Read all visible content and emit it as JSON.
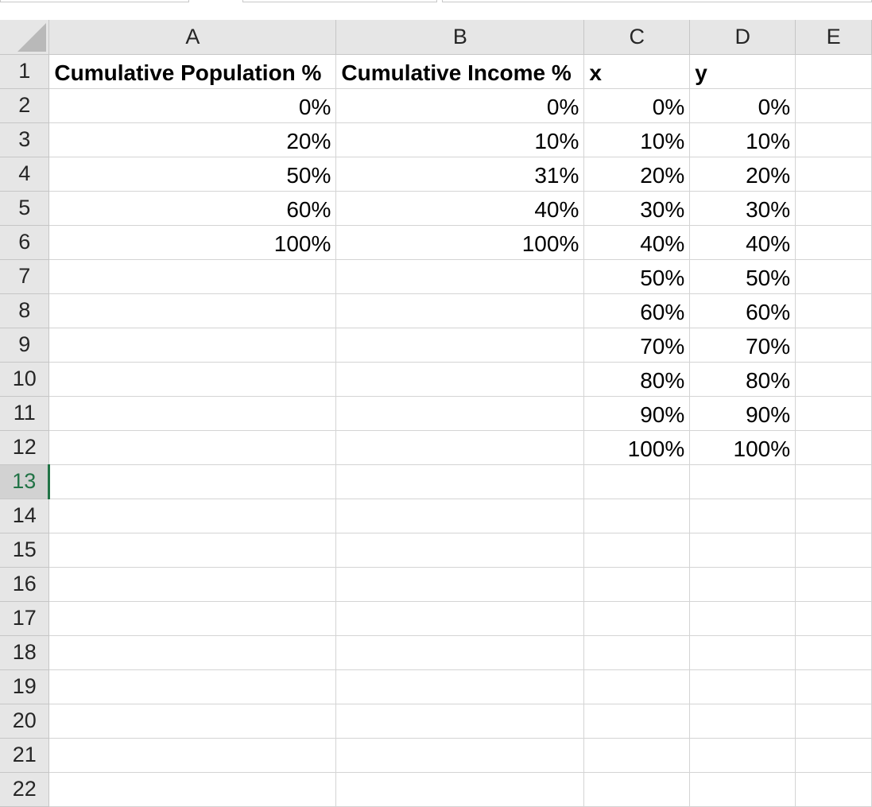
{
  "columns": [
    "A",
    "B",
    "C",
    "D",
    "E"
  ],
  "rows": [
    {
      "num": "1",
      "cells": [
        "Cumulative Population %",
        "Cumulative Income %",
        "x",
        "y",
        ""
      ]
    },
    {
      "num": "2",
      "cells": [
        "0%",
        "0%",
        "0%",
        "0%",
        ""
      ]
    },
    {
      "num": "3",
      "cells": [
        "20%",
        "10%",
        "10%",
        "10%",
        ""
      ]
    },
    {
      "num": "4",
      "cells": [
        "50%",
        "31%",
        "20%",
        "20%",
        ""
      ]
    },
    {
      "num": "5",
      "cells": [
        "60%",
        "40%",
        "30%",
        "30%",
        ""
      ]
    },
    {
      "num": "6",
      "cells": [
        "100%",
        "100%",
        "40%",
        "40%",
        ""
      ]
    },
    {
      "num": "7",
      "cells": [
        "",
        "",
        "50%",
        "50%",
        ""
      ]
    },
    {
      "num": "8",
      "cells": [
        "",
        "",
        "60%",
        "60%",
        ""
      ]
    },
    {
      "num": "9",
      "cells": [
        "",
        "",
        "70%",
        "70%",
        ""
      ]
    },
    {
      "num": "10",
      "cells": [
        "",
        "",
        "80%",
        "80%",
        ""
      ]
    },
    {
      "num": "11",
      "cells": [
        "",
        "",
        "90%",
        "90%",
        ""
      ]
    },
    {
      "num": "12",
      "cells": [
        "",
        "",
        "100%",
        "100%",
        ""
      ]
    },
    {
      "num": "13",
      "cells": [
        "",
        "",
        "",
        "",
        ""
      ]
    },
    {
      "num": "14",
      "cells": [
        "",
        "",
        "",
        "",
        ""
      ]
    },
    {
      "num": "15",
      "cells": [
        "",
        "",
        "",
        "",
        ""
      ]
    },
    {
      "num": "16",
      "cells": [
        "",
        "",
        "",
        "",
        ""
      ]
    },
    {
      "num": "17",
      "cells": [
        "",
        "",
        "",
        "",
        ""
      ]
    },
    {
      "num": "18",
      "cells": [
        "",
        "",
        "",
        "",
        ""
      ]
    },
    {
      "num": "19",
      "cells": [
        "",
        "",
        "",
        "",
        ""
      ]
    },
    {
      "num": "20",
      "cells": [
        "",
        "",
        "",
        "",
        ""
      ]
    },
    {
      "num": "21",
      "cells": [
        "",
        "",
        "",
        "",
        ""
      ]
    },
    {
      "num": "22",
      "cells": [
        "",
        "",
        "",
        "",
        ""
      ]
    }
  ],
  "active_row": "13",
  "colors": {
    "header_bg": "#e6e6e6",
    "active_accent": "#217346",
    "gridline": "#d4d4d4"
  }
}
